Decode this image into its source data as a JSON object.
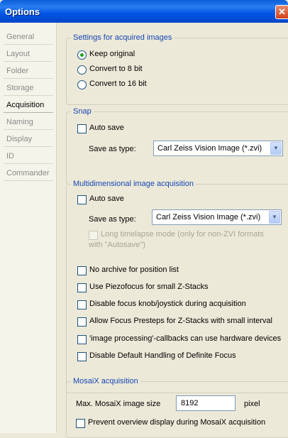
{
  "window": {
    "title": "Options",
    "close_glyph": "✕"
  },
  "nav": {
    "items": [
      {
        "label": "General"
      },
      {
        "label": "Layout"
      },
      {
        "label": "Folder"
      },
      {
        "label": "Storage"
      },
      {
        "label": "Acquisition"
      },
      {
        "label": "Naming"
      },
      {
        "label": "Display"
      },
      {
        "label": "ID"
      },
      {
        "label": "Commander"
      }
    ],
    "selected": "Acquisition"
  },
  "settings_acquired": {
    "legend": "Settings for acquired images",
    "options": [
      {
        "label": "Keep original",
        "checked": true
      },
      {
        "label": "Convert to 8 bit",
        "checked": false
      },
      {
        "label": "Convert to 16 bit",
        "checked": false
      }
    ]
  },
  "snap": {
    "legend": "Snap",
    "auto_save_label": "Auto save",
    "auto_save_checked": false,
    "save_as_type_label": "Save as type:",
    "save_as_type_value": "Carl Zeiss Vision Image (*.zvi)"
  },
  "multidim": {
    "legend": "Multidimensional image acquisition",
    "auto_save_label": "Auto save",
    "auto_save_checked": false,
    "save_as_type_label": "Save as type:",
    "save_as_type_value": "Carl Zeiss Vision Image (*.zvi)",
    "long_timelapse_line1": "Long timelapse mode (only for non-ZVI formats",
    "long_timelapse_line2": "with \"Autosave\")",
    "options": [
      {
        "label": "No archive for position list",
        "checked": false
      },
      {
        "label": "Use Piezofocus for small Z-Stacks",
        "checked": false
      },
      {
        "label": "Disable focus knob/joystick during acquisition",
        "checked": false
      },
      {
        "label": "Allow Focus Presteps for Z-Stacks with small interval",
        "checked": false
      },
      {
        "label": "'image processing'-callbacks can use hardware devices",
        "checked": false
      },
      {
        "label": "Disable Default Handling of Definite Focus",
        "checked": false
      }
    ]
  },
  "mosaix": {
    "legend": "MosaiX acquisition",
    "max_size_label": "Max. MosaiX image size",
    "max_size_value": "8192",
    "unit": "pixel",
    "prevent_label": "Prevent overview display during MosaiX acquisition",
    "prevent_checked": false
  },
  "colors": {
    "legend": "#1646b5",
    "titlebar": "#0055e5",
    "radio_dot": "#21a121"
  }
}
